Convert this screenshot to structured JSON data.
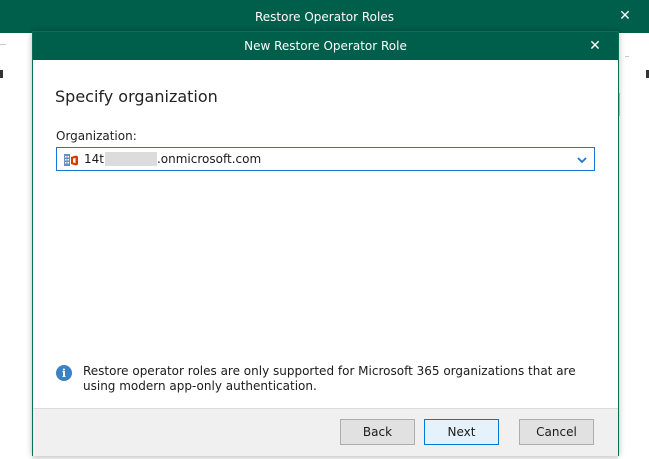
{
  "parent_window": {
    "title": "Restore Operator Roles",
    "close_glyph": "✕"
  },
  "dialog": {
    "title": "New Restore Operator Role",
    "close_glyph": "✕"
  },
  "step": {
    "heading": "Specify organization"
  },
  "organization": {
    "label": "Organization:",
    "value_prefix": "14t",
    "value_suffix": ".onmicrosoft.com",
    "icon": "office-organization-icon"
  },
  "info": {
    "icon": "info-icon",
    "glyph": "i",
    "text": "Restore operator roles are only supported for Microsoft 365 organizations that are using modern app-only authentication."
  },
  "buttons": {
    "back": "Back",
    "next": "Next",
    "cancel": "Cancel"
  },
  "colors": {
    "titlebar": "#005f4b",
    "focus_border": "#1976d2",
    "info_blue": "#3b82c4"
  }
}
